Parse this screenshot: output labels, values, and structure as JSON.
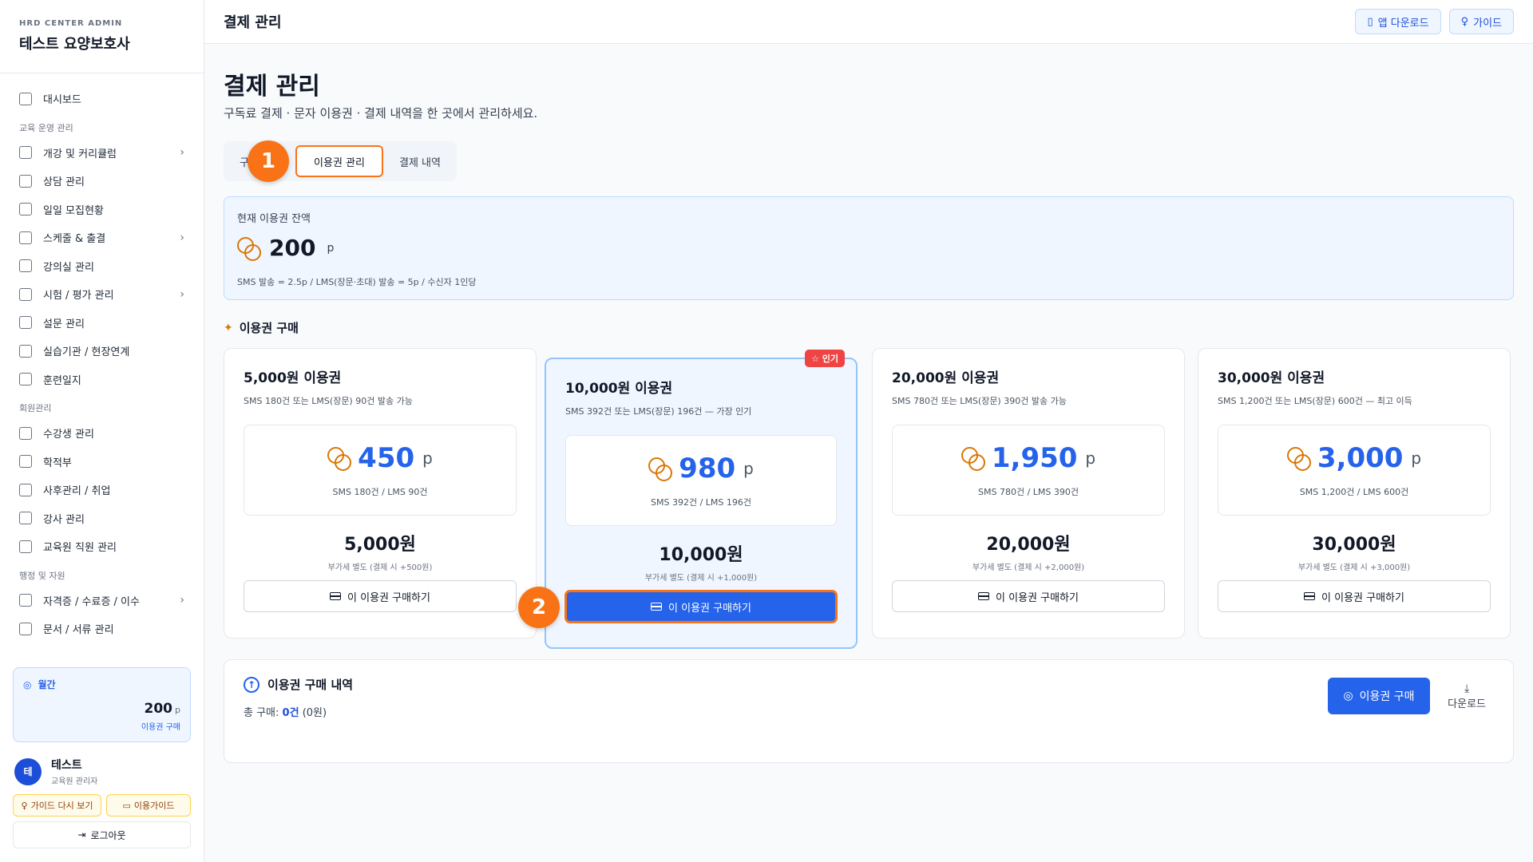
{
  "sidebar": {
    "brand_sub": "HRD CENTER ADMIN",
    "brand_title": "테스트 요양보호사",
    "items": [
      {
        "type": "item",
        "label": "대시보드",
        "icon": "dashboard-icon",
        "chevron": false
      },
      {
        "type": "group",
        "label": "교육 운영 관리"
      },
      {
        "type": "item",
        "label": "개강 및 커리큘럼",
        "icon": "book-icon",
        "chevron": true
      },
      {
        "type": "item",
        "label": "상담 관리",
        "icon": "chat-icon",
        "chevron": false
      },
      {
        "type": "item",
        "label": "일일 모집현황",
        "icon": "clipboard-icon",
        "chevron": false
      },
      {
        "type": "item",
        "label": "스케줄 & 출결",
        "icon": "calendar-icon",
        "chevron": true
      },
      {
        "type": "item",
        "label": "강의실 관리",
        "icon": "building-icon",
        "chevron": false
      },
      {
        "type": "item",
        "label": "시험 / 평가 관리",
        "icon": "clipboard-check-icon",
        "chevron": true
      },
      {
        "type": "item",
        "label": "설문 관리",
        "icon": "clipboard-list-icon",
        "chevron": false
      },
      {
        "type": "item",
        "label": "실습기관 / 현장연계",
        "icon": "building-icon",
        "chevron": false
      },
      {
        "type": "item",
        "label": "훈련일지",
        "icon": "file-text-icon",
        "chevron": false
      },
      {
        "type": "group",
        "label": "회원관리"
      },
      {
        "type": "item",
        "label": "수강생 관리",
        "icon": "users-icon",
        "chevron": false
      },
      {
        "type": "item",
        "label": "학적부",
        "icon": "graduation-cap-icon",
        "chevron": false
      },
      {
        "type": "item",
        "label": "사후관리 / 취업",
        "icon": "briefcase-icon",
        "chevron": false
      },
      {
        "type": "item",
        "label": "강사 관리",
        "icon": "user-circle-icon",
        "chevron": false
      },
      {
        "type": "item",
        "label": "교육원 직원 관리",
        "icon": "user-cog-icon",
        "chevron": false
      },
      {
        "type": "group",
        "label": "행정 및 자원"
      },
      {
        "type": "item",
        "label": "자격증 / 수료증 / 이수",
        "icon": "award-icon",
        "chevron": true
      },
      {
        "type": "item",
        "label": "문서 / 서류 관리",
        "icon": "folder-icon",
        "chevron": false
      }
    ],
    "credit": {
      "label": "월간",
      "value": "200",
      "unit": "p",
      "link": "이용권 구매"
    },
    "user": {
      "initial": "테",
      "name": "테스트",
      "role": "교육원 관리자"
    },
    "guide_again": "가이드 다시 보기",
    "usage_guide": "이용가이드",
    "logout": "로그아웃"
  },
  "topbar": {
    "title": "결제 관리",
    "app_download": "앱 다운로드",
    "guide": "가이드"
  },
  "main": {
    "title": "결제 관리",
    "description": "구독료 결제 · 문자 이용권 · 결제 내역을 한 곳에서 관리하세요.",
    "tabs": [
      {
        "label": "구독 관리",
        "visible_text": "구"
      },
      {
        "label": "이용권 관리"
      },
      {
        "label": "결제 내역"
      }
    ],
    "step1": "1",
    "step2": "2",
    "balance": {
      "label": "현재 이용권 잔액",
      "value": "200",
      "unit": "p",
      "note": "SMS 발송 = 2.5p / LMS(장문·초대) 발송 = 5p / 수신자 1인당"
    },
    "purchase_title": "이용권 구매",
    "popular_badge": "☆ 인기",
    "cards": [
      {
        "title": "5,000원 이용권",
        "desc": "SMS 180건 또는 LMS(장문) 90건 발송 가능",
        "points": "450",
        "unit": "p",
        "sub": "SMS 180건 / LMS 90건",
        "price": "5,000원",
        "vat": "부가세 별도 (결제 시 +500원)",
        "button": "이 이용권 구매하기"
      },
      {
        "title": "10,000원 이용권",
        "desc": "SMS 392건 또는 LMS(장문) 196건 — 가장 인기",
        "points": "980",
        "unit": "p",
        "sub": "SMS 392건 / LMS 196건",
        "price": "10,000원",
        "vat": "부가세 별도 (결제 시 +1,000원)",
        "button": "이 이용권 구매하기"
      },
      {
        "title": "20,000원 이용권",
        "desc": "SMS 780건 또는 LMS(장문) 390건 발송 가능",
        "points": "1,950",
        "unit": "p",
        "sub": "SMS 780건 / LMS 390건",
        "price": "20,000원",
        "vat": "부가세 별도 (결제 시 +2,000원)",
        "button": "이 이용권 구매하기"
      },
      {
        "title": "30,000원 이용권",
        "desc": "SMS 1,200건 또는 LMS(장문) 600건 — 최고 이득",
        "points": "3,000",
        "unit": "p",
        "sub": "SMS 1,200건 / LMS 600건",
        "price": "30,000원",
        "vat": "부가세 별도 (결제 시 +3,000원)",
        "button": "이 이용권 구매하기"
      }
    ],
    "history": {
      "title": "이용권 구매 내역",
      "total_label": "총 구매:",
      "total_count": "0건",
      "total_amount": "(0원)",
      "buy_button": "이용권 구매",
      "download": "다운로드"
    }
  },
  "colors": {
    "accent": "#2563eb",
    "highlight": "#f97316",
    "coin": "#d97706",
    "popular": "#ef4444"
  }
}
